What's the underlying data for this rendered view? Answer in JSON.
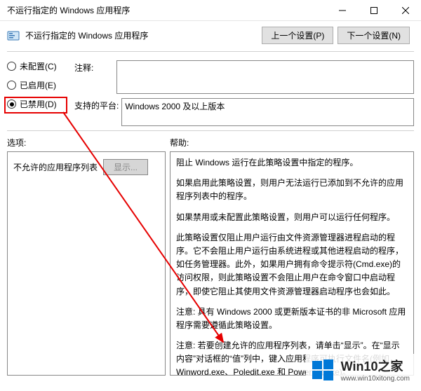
{
  "window": {
    "title": "不运行指定的 Windows 应用程序"
  },
  "header": {
    "title": "不运行指定的 Windows 应用程序"
  },
  "nav": {
    "prev": "上一个设置(P)",
    "next": "下一个设置(N)"
  },
  "radios": {
    "not_configured": "未配置(C)",
    "enabled": "已启用(E)",
    "disabled": "已禁用(D)"
  },
  "fields": {
    "comment_label": "注释:",
    "comment_value": "",
    "platform_label": "支持的平台:",
    "platform_value": "Windows 2000 及以上版本"
  },
  "sections": {
    "options": "选项:",
    "help": "帮助:"
  },
  "options": {
    "list_label": "不允许的应用程序列表",
    "show_btn": "显示..."
  },
  "help": {
    "p1": "阻止 Windows 运行在此策略设置中指定的程序。",
    "p2": "如果启用此策略设置，则用户无法运行已添加到不允许的应用程序列表中的程序。",
    "p3": "如果禁用或未配置此策略设置，则用户可以运行任何程序。",
    "p4": "此策略设置仅阻止用户运行由文件资源管理器进程启动的程序。它不会阻止用户运行由系统进程或其他进程启动的程序，如任务管理器。此外，如果用户拥有命令提示符(Cmd.exe)的访问权限，则此策略设置不会阻止用户在命令窗口中启动程序，即使它阻止其使用文件资源管理器启动程序也会如此。",
    "p5": "注意: 具有 Windows 2000 或更新版本证书的非 Microsoft 应用程序需要遵循此策略设置。",
    "p6": "注意: 若要创建允许的应用程序列表，请单击“显示”。在“显示内容”对话框的“值”列中，键入应用程序可执行文件名(例如，Winword.exe、Poledit.exe 和 Powerpnt.exe)。"
  },
  "watermark": {
    "big": "Win10之家",
    "small": "www.win10xitong.com"
  }
}
